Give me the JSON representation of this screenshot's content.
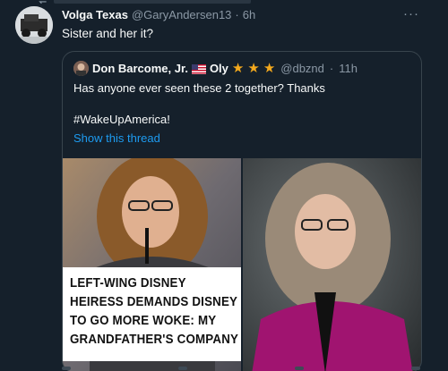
{
  "tweet": {
    "author_name": "Volga Texas",
    "author_handle": "@GaryAndersen13",
    "separator": "·",
    "time": "6h",
    "text": "Sister and her it?",
    "more_icon": "more-horizontal-icon"
  },
  "quote": {
    "author_name": "Don Barcome, Jr.",
    "author_suffix": "Oly",
    "stars": [
      "★",
      "★",
      "★"
    ],
    "author_handle": "@dbznd",
    "separator": "·",
    "time": "11h",
    "text_line1": "Has anyone ever seen these 2 together?  Thanks",
    "text_line2": "#WakeUpAmerica!",
    "show_thread": "Show this thread",
    "headline": "LEFT-WING DISNEY HEIRESS DEMANDS DISNEY TO GO MORE WOKE: MY GRANDFATHER'S COMPANY"
  },
  "colors": {
    "background": "#15202b",
    "text": "#f7f9f9",
    "muted": "#8b98a5",
    "link": "#1d9bf0",
    "border": "#38444d",
    "star": "#f4a91d"
  }
}
